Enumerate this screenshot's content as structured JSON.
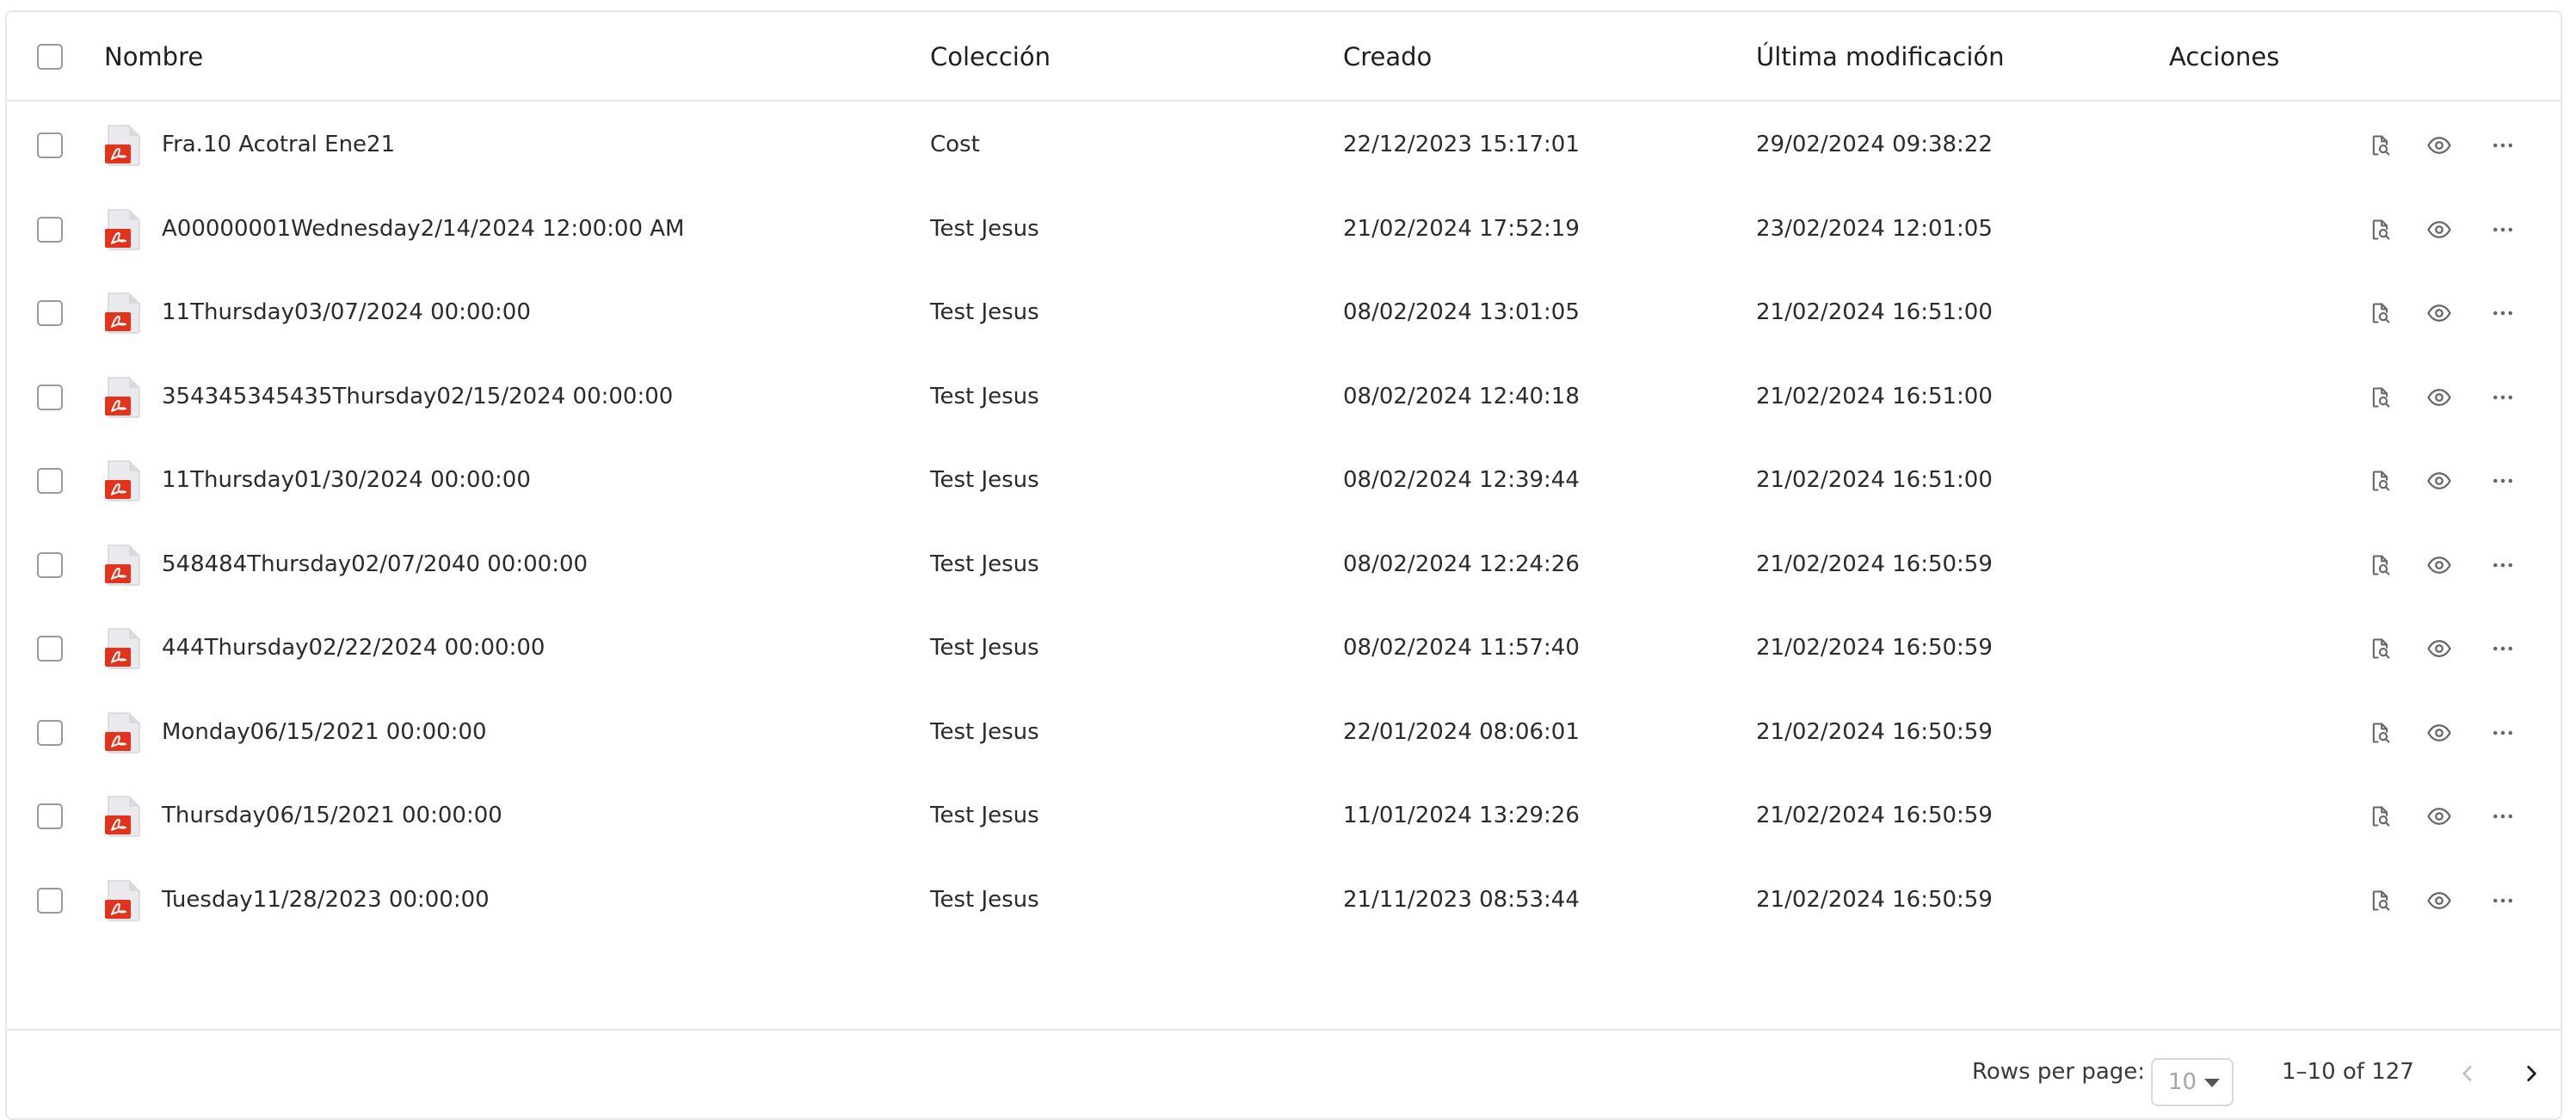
{
  "table": {
    "columns": {
      "name": "Nombre",
      "collection": "Colección",
      "created": "Creado",
      "modified": "Última modificación",
      "actions": "Acciones"
    },
    "rows": [
      {
        "name": "Fra.10 Acotral Ene21",
        "collection": "Cost",
        "created": "22/12/2023 15:17:01",
        "modified": "29/02/2024 09:38:22"
      },
      {
        "name": "A00000001Wednesday2/14/2024 12:00:00 AM",
        "collection": "Test Jesus",
        "created": "21/02/2024 17:52:19",
        "modified": "23/02/2024 12:01:05"
      },
      {
        "name": "11Thursday03/07/2024 00:00:00",
        "collection": "Test Jesus",
        "created": "08/02/2024 13:01:05",
        "modified": "21/02/2024 16:51:00"
      },
      {
        "name": "354345345435Thursday02/15/2024 00:00:00",
        "collection": "Test Jesus",
        "created": "08/02/2024 12:40:18",
        "modified": "21/02/2024 16:51:00"
      },
      {
        "name": "11Thursday01/30/2024 00:00:00",
        "collection": "Test Jesus",
        "created": "08/02/2024 12:39:44",
        "modified": "21/02/2024 16:51:00"
      },
      {
        "name": "548484Thursday02/07/2040 00:00:00",
        "collection": "Test Jesus",
        "created": "08/02/2024 12:24:26",
        "modified": "21/02/2024 16:50:59"
      },
      {
        "name": "444Thursday02/22/2024 00:00:00",
        "collection": "Test Jesus",
        "created": "08/02/2024 11:57:40",
        "modified": "21/02/2024 16:50:59"
      },
      {
        "name": "Monday06/15/2021 00:00:00",
        "collection": "Test Jesus",
        "created": "22/01/2024 08:06:01",
        "modified": "21/02/2024 16:50:59"
      },
      {
        "name": "Thursday06/15/2021 00:00:00",
        "collection": "Test Jesus",
        "created": "11/01/2024 13:29:26",
        "modified": "21/02/2024 16:50:59"
      },
      {
        "name": "Tuesday11/28/2023 00:00:00",
        "collection": "Test Jesus",
        "created": "21/11/2023 08:53:44",
        "modified": "21/02/2024 16:50:59"
      }
    ],
    "row_icons": [
      "pdf-file-icon",
      "file-search-icon",
      "eye-icon",
      "more-horizontal-icon"
    ]
  },
  "pagination": {
    "rows_per_page_label": "Rows per page:",
    "rows_per_page_value": "10",
    "range": "1–10 of 127",
    "prev_icon": "chevron-left-icon",
    "next_icon": "chevron-right-icon"
  },
  "colors": {
    "pdf_red": "#e2341d",
    "border": "#e6e6e6",
    "icon": "#666666"
  }
}
